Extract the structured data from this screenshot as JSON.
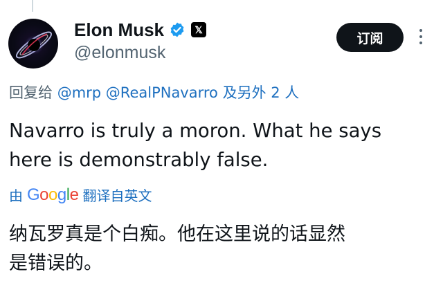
{
  "author": {
    "name": "Elon Musk",
    "handle": "@elonmusk",
    "avatar_icon": "black-hole-avatar",
    "verified_icon": "verified-badge-icon",
    "affiliation_icon": "x-logo-icon"
  },
  "actions": {
    "subscribe_label": "订阅",
    "more_icon": "more-vertical-icon"
  },
  "reply": {
    "prefix": "回复给",
    "mention_1": "@mrp",
    "mention_2": "@RealPNavarro",
    "suffix": "及另外 2 人"
  },
  "tweet": {
    "line_1": "Navarro is truly a moron. What he says",
    "line_2": "here is demonstrably false."
  },
  "translation": {
    "by": "由",
    "google_letters": [
      "G",
      "o",
      "o",
      "g",
      "l",
      "e"
    ],
    "google_colors": [
      "#4285F4",
      "#EA4335",
      "#FBBC05",
      "#4285F4",
      "#34A853",
      "#EA4335"
    ],
    "from_label": "翻译自英文",
    "line_1": "纳瓦罗真是个白痴。他在这里说的话显然",
    "line_2": "是错误的。"
  },
  "colors": {
    "text": "#0f1419",
    "secondary": "#536471",
    "link": "#1d6fbf",
    "verified": "#1d9bf0",
    "button_bg": "#0f1419"
  }
}
